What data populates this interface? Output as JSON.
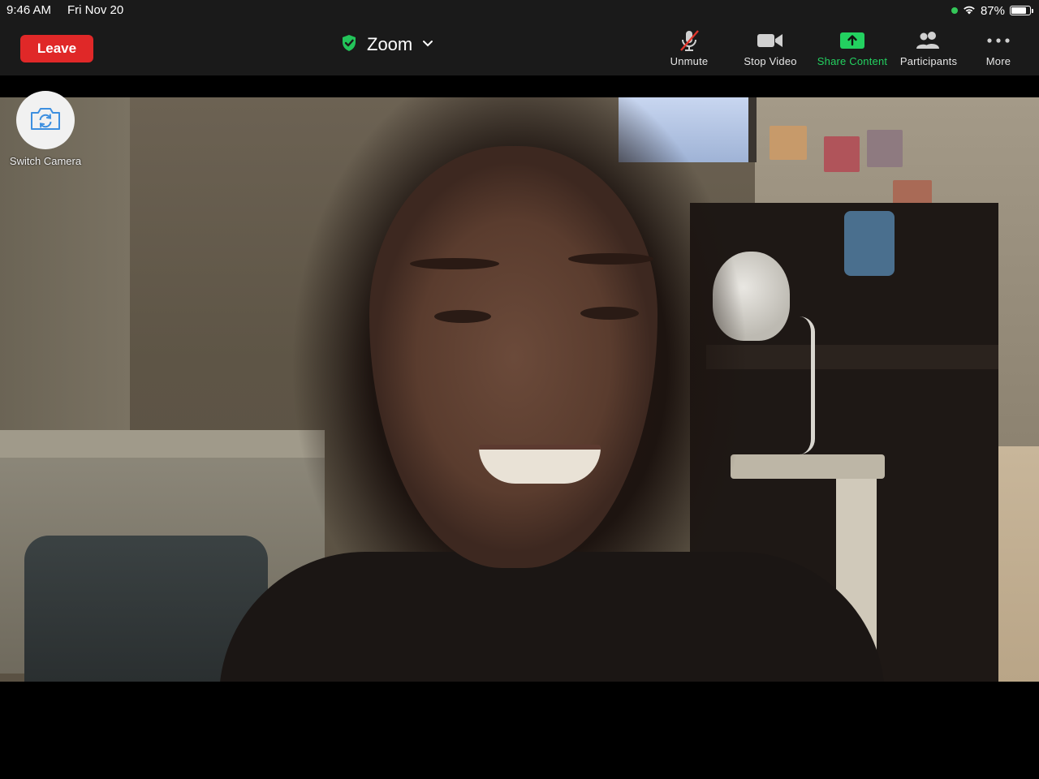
{
  "status_bar": {
    "time": "9:46 AM",
    "date": "Fri Nov 20",
    "battery_percent": "87%",
    "battery_level": 0.87,
    "recording_dot_color": "#34c759"
  },
  "toolbar": {
    "leave_label": "Leave",
    "leave_color": "#e02828",
    "meeting_title": "Zoom",
    "security_icon": "shield-check-icon",
    "buttons": [
      {
        "label": "Unmute",
        "icon": "microphone-muted-icon"
      },
      {
        "label": "Stop Video",
        "icon": "video-camera-icon"
      },
      {
        "label": "Share Content",
        "icon": "share-screen-icon",
        "color": "#23d160"
      },
      {
        "label": "Participants",
        "icon": "participants-icon"
      },
      {
        "label": "More",
        "icon": "more-dots-icon"
      }
    ]
  },
  "video": {
    "switch_camera_label": "Switch Camera",
    "switch_camera_icon": "camera-rotate-icon"
  }
}
